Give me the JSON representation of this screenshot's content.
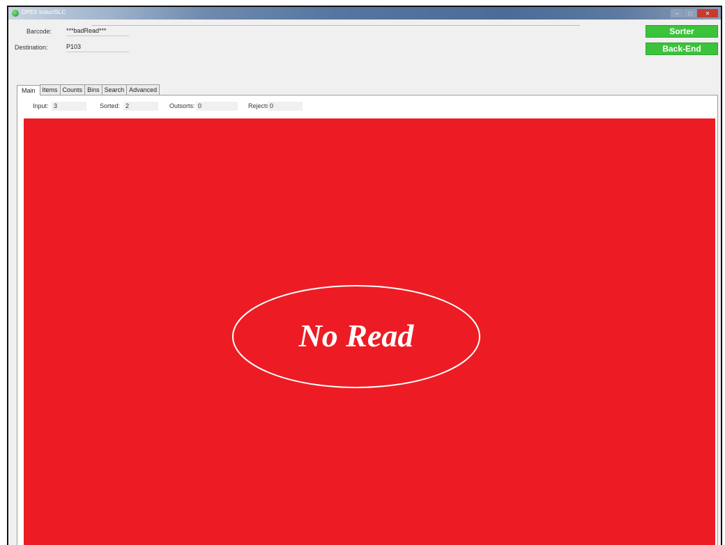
{
  "window": {
    "title": "OPEX InductSLC"
  },
  "header": {
    "barcode_label": "Barcode:",
    "barcode_value": "***badRead***",
    "destination_label": "Destination:",
    "destination_value": "P103"
  },
  "buttons": {
    "sorter": "Sorter",
    "back_end": "Back-End",
    "color": "#3cc33c"
  },
  "tabs": [
    "Main",
    "Items",
    "Counts",
    "Bins",
    "Search",
    "Advanced"
  ],
  "active_tab": "Main",
  "counters": {
    "input_label": "Input:",
    "input_value": "3",
    "sorted_label": "Sorted:",
    "sorted_value": "2",
    "outsorts_label": "Outsorts:",
    "outsorts_value": "0",
    "rejects_label": "Rejects:",
    "rejects_value": "0"
  },
  "status": {
    "message": "No Read",
    "background_color": "#ed1c24",
    "text_color": "#ffffff"
  }
}
